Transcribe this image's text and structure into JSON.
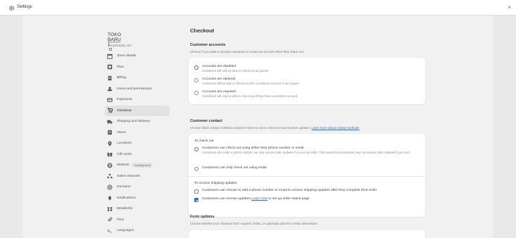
{
  "topbar": {
    "title": "Settings",
    "close_glyph": "×"
  },
  "store": {
    "name": "TOKO BARU 1",
    "url": "tokobaru-1.myshopify.com"
  },
  "nav": [
    {
      "label": "Store details",
      "icon": "store-icon"
    },
    {
      "label": "Plan",
      "icon": "plan-icon"
    },
    {
      "label": "Billing",
      "icon": "billing-icon"
    },
    {
      "label": "Users and permissions",
      "icon": "users-icon"
    },
    {
      "label": "Payments",
      "icon": "payments-icon"
    },
    {
      "label": "Checkout",
      "icon": "checkout-icon",
      "active": true
    },
    {
      "label": "Shipping and delivery",
      "icon": "shipping-icon"
    },
    {
      "label": "Taxes",
      "icon": "taxes-icon"
    },
    {
      "label": "Locations",
      "icon": "location-icon"
    },
    {
      "label": "Gift cards",
      "icon": "gift-icon"
    },
    {
      "label": "Markets",
      "icon": "globe-icon",
      "badge": "Coming soon"
    },
    {
      "label": "Sales channels",
      "icon": "channels-icon"
    },
    {
      "label": "Domains",
      "icon": "domains-icon"
    },
    {
      "label": "Notifications",
      "icon": "bell-icon"
    },
    {
      "label": "Metafields",
      "icon": "metafields-icon"
    },
    {
      "label": "Files",
      "icon": "files-icon"
    },
    {
      "label": "Languages",
      "icon": "languages-icon"
    }
  ],
  "page": {
    "title": "Checkout"
  },
  "accounts": {
    "heading": "Customer accounts",
    "description": "Choose if you want to prompt customers to create an account when they check out.",
    "options": [
      {
        "label": "Accounts are disabled",
        "help": "Customers will only be able to check out as guests.",
        "selected": true
      },
      {
        "label": "Accounts are optional",
        "help": "Customers will be able to check out with a customer account or as a guest.",
        "selected": false
      },
      {
        "label": "Accounts are required",
        "help": "Customers will only be able to check out if they have a customer account.",
        "selected": false
      }
    ]
  },
  "contact": {
    "heading": "Customer contact",
    "description": "Choose which contact method customers have to use to check out and receive updates.",
    "link": "Learn more about contact methods",
    "to_checkout": {
      "heading": "To check out",
      "options": [
        {
          "label": "Customers can check out using either their phone number or email",
          "help": "Customers who enter a phone number can only receive order updates if you set up SMS. This means that customers may not receive order updates if you don't.",
          "selected": true
        },
        {
          "label": "Customers can only check out using email",
          "help": "",
          "selected": false
        }
      ]
    },
    "updates": {
      "heading": "To receive shipping updates",
      "options": [
        {
          "label": "Customers can choose to add a phone number or email to receive shipping updates after they complete their order",
          "checked": false
        },
        {
          "label_pre": "Customers can receive updates",
          "link": "Learn how",
          "label_post": "to set up order status page",
          "checked": true
        }
      ]
    }
  },
  "form_options": {
    "heading": "Form options",
    "description": "Choose whether your checkout form requires, hides, or optionally asks for certain information."
  }
}
